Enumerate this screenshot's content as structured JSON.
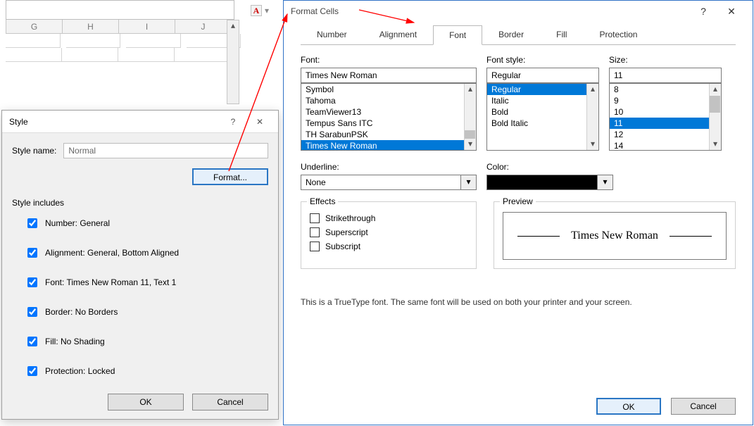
{
  "sheet": {
    "name_chip": "A",
    "columns": [
      "G",
      "H",
      "I",
      "J"
    ]
  },
  "style_dialog": {
    "title": "Style",
    "help": "?",
    "close": "✕",
    "name_label": "Style name:",
    "name_value": "Normal",
    "format_btn": "Format...",
    "includes_label": "Style includes",
    "checks": [
      {
        "label": "Number: General"
      },
      {
        "label": "Alignment: General, Bottom Aligned"
      },
      {
        "label": "Font: Times New Roman 11, Text 1"
      },
      {
        "label": "Border: No Borders"
      },
      {
        "label": "Fill: No Shading"
      },
      {
        "label": "Protection: Locked"
      }
    ],
    "ok": "OK",
    "cancel": "Cancel"
  },
  "format_cells": {
    "title": "Format Cells",
    "help": "?",
    "close": "✕",
    "tabs": [
      "Number",
      "Alignment",
      "Font",
      "Border",
      "Fill",
      "Protection"
    ],
    "active_tab": "Font",
    "font_label": "Font:",
    "font_value": "Times New Roman",
    "font_list": [
      "Symbol",
      "Tahoma",
      "TeamViewer13",
      "Tempus Sans ITC",
      "TH SarabunPSK",
      "Times New Roman"
    ],
    "font_selected": "Times New Roman",
    "style_label": "Font style:",
    "style_value": "Regular",
    "style_list": [
      "Regular",
      "Italic",
      "Bold",
      "Bold Italic"
    ],
    "style_selected": "Regular",
    "size_label": "Size:",
    "size_value": "11",
    "size_list": [
      "8",
      "9",
      "10",
      "11",
      "12",
      "14"
    ],
    "size_selected": "11",
    "underline_label": "Underline:",
    "underline_value": "None",
    "color_label": "Color:",
    "effects_legend": "Effects",
    "effects": [
      "Strikethrough",
      "Superscript",
      "Subscript"
    ],
    "preview_legend": "Preview",
    "preview_text": "Times New Roman",
    "footnote": "This is a TrueType font.  The same font will be used on both your printer and your screen.",
    "ok": "OK",
    "cancel": "Cancel"
  }
}
